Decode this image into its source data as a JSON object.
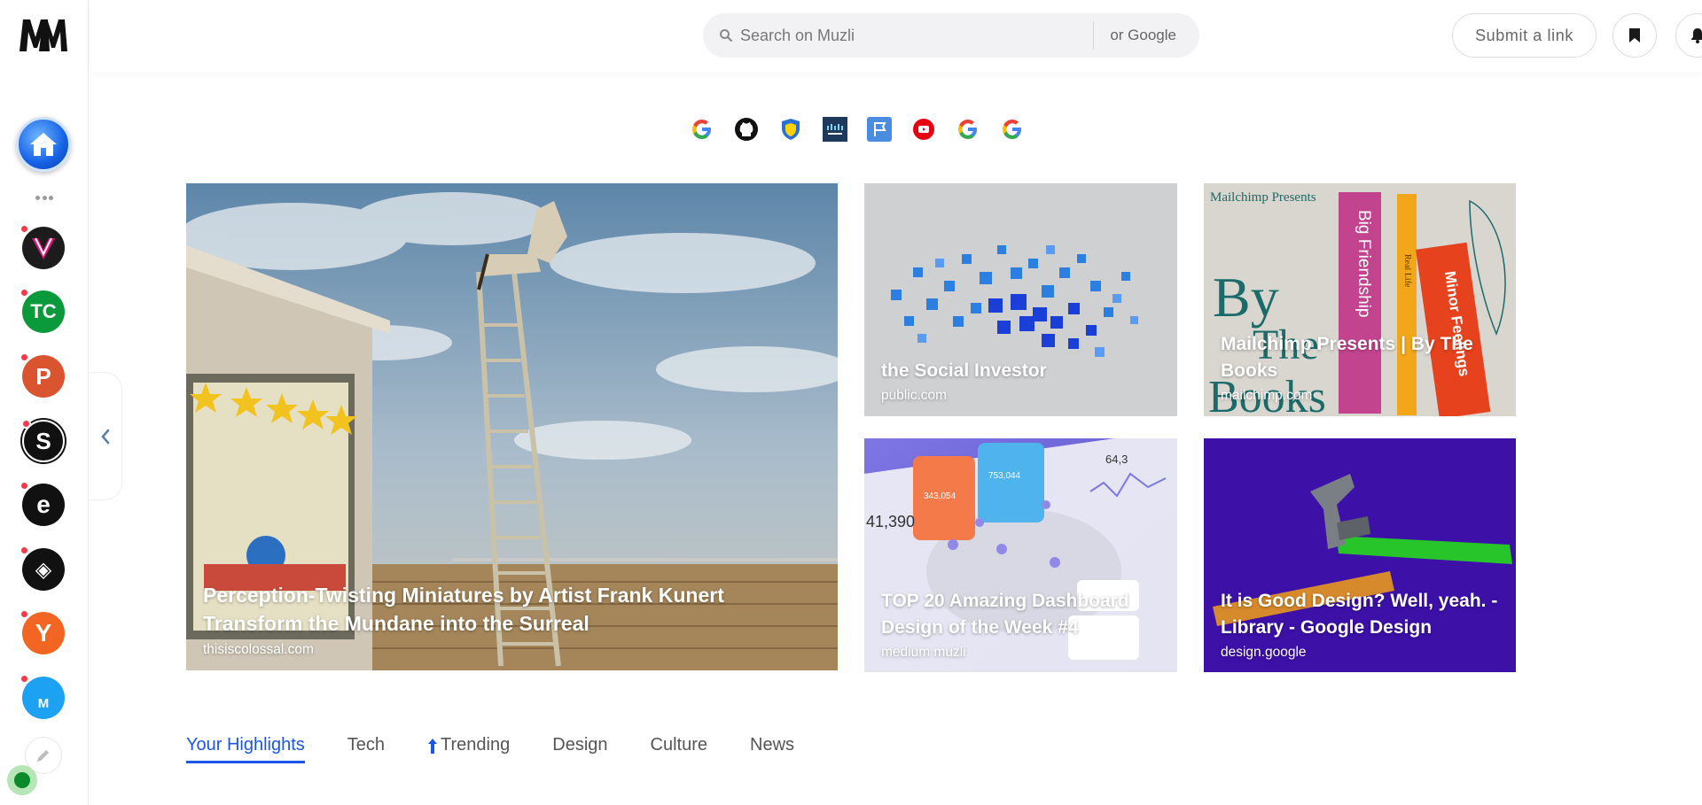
{
  "sidebar": {
    "logo_text": "MM",
    "home_label": "Home",
    "sources": [
      {
        "name": "The Verge",
        "color": "#1c1c1c",
        "glyph": "V"
      },
      {
        "name": "TechCrunch",
        "color": "#0a9a3c",
        "glyph": "TC"
      },
      {
        "name": "Product Hunt",
        "color": "#da552f",
        "glyph": "P"
      },
      {
        "name": "Smashing",
        "color": "#111111",
        "glyph": "S"
      },
      {
        "name": "Engadget",
        "color": "#111111",
        "glyph": "e"
      },
      {
        "name": "CodePen",
        "color": "#111111",
        "glyph": "◈"
      },
      {
        "name": "Y Combinator",
        "color": "#f26522",
        "glyph": "Y"
      },
      {
        "name": "Medium Muzli",
        "color": "#1da1f2",
        "glyph": "M"
      }
    ],
    "edit_icon": "pencil-icon",
    "status_color": "#0a8a2a"
  },
  "header": {
    "search_placeholder": "Search on Muzli",
    "or_google": "or Google",
    "submit_label": "Submit a link",
    "icons": [
      "bookmark-icon",
      "bell-icon",
      "settings-icon"
    ]
  },
  "quick_links": [
    "google-icon",
    "github-icon",
    "shield-icon",
    "cisco-icon",
    "flag-icon",
    "youtube-icon",
    "google-icon",
    "google-icon"
  ],
  "featured": {
    "main": {
      "title": "Perception-Twisting Miniatures by Artist Frank Kunert Transform the Mundane into the Surreal",
      "source": "thisiscolossal.com"
    },
    "cards": [
      {
        "title": "the Social Investor",
        "source": "public.com"
      },
      {
        "title": "Mailchimp Presents | By The Books",
        "source": "mailchimp.com"
      },
      {
        "title": "TOP 20 Amazing Dashboard Design of the Week #4",
        "source": "medium muzli"
      },
      {
        "title": "It is Good Design? Well, yeah. - Library - Google Design",
        "source": "design.google"
      }
    ],
    "mailchimp_art": {
      "brand": "Mailchimp Presents",
      "book1": "Big Friendship",
      "book2": "Real Life",
      "book3": "Minor Feelings",
      "big_text": "By The Books"
    },
    "dashboard_art": {
      "number": "41,390",
      "stat1": "343,054",
      "stat2": "753,044",
      "stat3": "64,3"
    }
  },
  "tabs": [
    "Your Highlights",
    "Tech",
    "Trending",
    "Design",
    "Culture",
    "News"
  ],
  "colors": {
    "accent": "#1a56e8",
    "notification": "#ef3b4a",
    "design_card_bg": "#3d10a8"
  }
}
